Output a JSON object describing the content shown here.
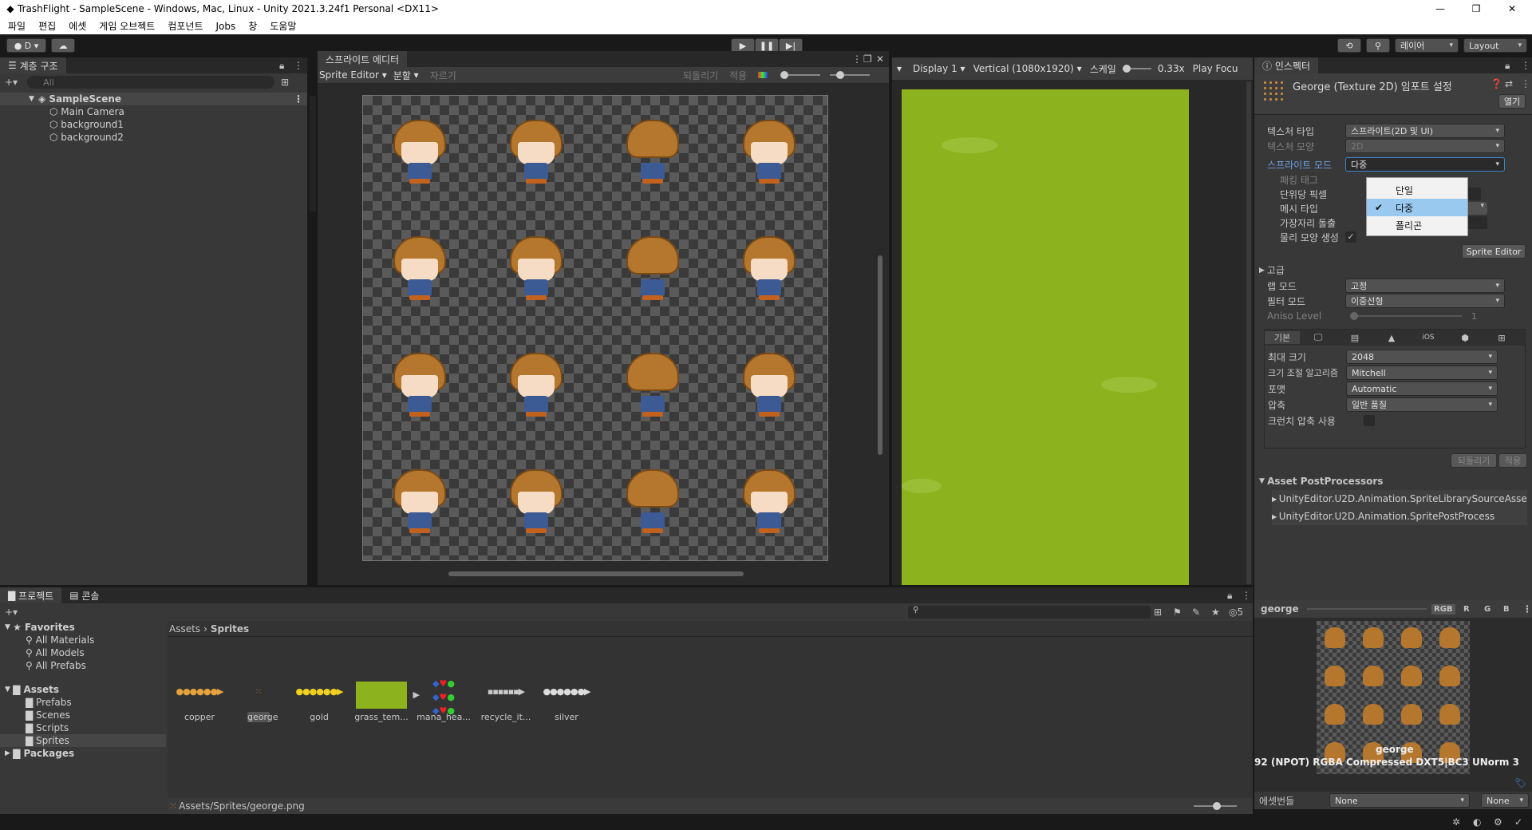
{
  "window": {
    "title": "TrashFlight - SampleScene - Windows, Mac, Linux - Unity 2021.3.24f1 Personal <DX11>"
  },
  "menu": [
    "파일",
    "편집",
    "에셋",
    "게임 오브젝트",
    "컴포넌트",
    "Jobs",
    "창",
    "도움말"
  ],
  "toolbar": {
    "account": "D",
    "layers": "레이어",
    "layout": "Layout"
  },
  "hierarchy": {
    "tab": "계층 구조",
    "search_placeholder": "All",
    "scene": "SampleScene",
    "items": [
      "Main Camera",
      "background1",
      "background2"
    ]
  },
  "sprite_editor": {
    "tab": "스프라이트 에디터",
    "mode": "Sprite Editor",
    "slice": "분할",
    "trim": "자르기",
    "revert": "되돌리기",
    "apply": "적용"
  },
  "game_view": {
    "display": "Display 1",
    "resolution": "Vertical (1080x1920)",
    "scale_label": "스케일",
    "scale_value": "0.33x",
    "play_focus": "Play Focu"
  },
  "inspector": {
    "tab": "인스펙터",
    "asset_title": "George (Texture 2D) 임포트 설정",
    "open_button": "열기",
    "rows": {
      "texture_type": {
        "label": "텍스처 타입",
        "value": "스프라이트(2D 및 UI)"
      },
      "texture_shape": {
        "label": "텍스처 모양",
        "value": "2D"
      },
      "sprite_mode": {
        "label": "스프라이트 모드",
        "value": "다중"
      },
      "packing_tag": {
        "label": "패킹 태그"
      },
      "ppu": {
        "label": "단위당 픽셀"
      },
      "mesh_type": {
        "label": "메시 타입"
      },
      "extrude": {
        "label": "가장자리 돌출",
        "value": "1"
      },
      "physics_shape": {
        "label": "물리 모양 생성"
      }
    },
    "sprite_mode_options": [
      "단일",
      "다중",
      "폴리곤"
    ],
    "sprite_mode_selected": "다중",
    "sprite_editor_button": "Sprite Editor",
    "advanced": "고급",
    "wrap_mode": {
      "label": "랩 모드",
      "value": "고정"
    },
    "filter_mode": {
      "label": "필터 모드",
      "value": "이중선형"
    },
    "aniso": {
      "label": "Aniso Level",
      "value": "1"
    },
    "platform_tabs": [
      "기본",
      "monitor-icon",
      "server-icon",
      "android-icon",
      "iOS",
      "webgl-icon",
      "windows-icon"
    ],
    "max_size": {
      "label": "최대 크기",
      "value": "2048"
    },
    "resize_algo": {
      "label": "크기 조절 알고리즘",
      "value": "Mitchell"
    },
    "format": {
      "label": "포맷",
      "value": "Automatic"
    },
    "compression": {
      "label": "압축",
      "value": "일반 품질"
    },
    "crunch": {
      "label": "크런치 압축 사용"
    },
    "revert": "되돌리기",
    "apply": "적용",
    "postprocessors_title": "Asset PostProcessors",
    "postprocessors": [
      "UnityEditor.U2D.Animation.SpriteLibrarySourceAsse",
      "UnityEditor.U2D.Animation.SpritePostProcess"
    ],
    "preview_name": "george",
    "preview_channels": [
      "RGB",
      "R",
      "G",
      "B"
    ],
    "preview_caption": "george",
    "preview_info": "92 (NPOT)  RGBA Compressed DXT5|BC3 UNorm  3",
    "asset_bundle_label": "에셋번들",
    "bundle_none_1": "None",
    "bundle_none_2": "None"
  },
  "project": {
    "tabs": [
      "프로젝트",
      "콘솔"
    ],
    "favorites": "Favorites",
    "fav_items": [
      "All Materials",
      "All Models",
      "All Prefabs"
    ],
    "assets": "Assets",
    "asset_folders": [
      "Prefabs",
      "Scenes",
      "Scripts",
      "Sprites"
    ],
    "packages": "Packages",
    "breadcrumb": [
      "Assets",
      "Sprites"
    ],
    "files": [
      "copper",
      "george",
      "gold",
      "grass_tem...",
      "mana_hea...",
      "recycle_it...",
      "silver"
    ],
    "path": "Assets/Sprites/george.png",
    "hidden_count": "5"
  },
  "colors": {
    "accent": "#3d86d0",
    "grass": "#8cb21e",
    "selection": "#4d77b5"
  }
}
